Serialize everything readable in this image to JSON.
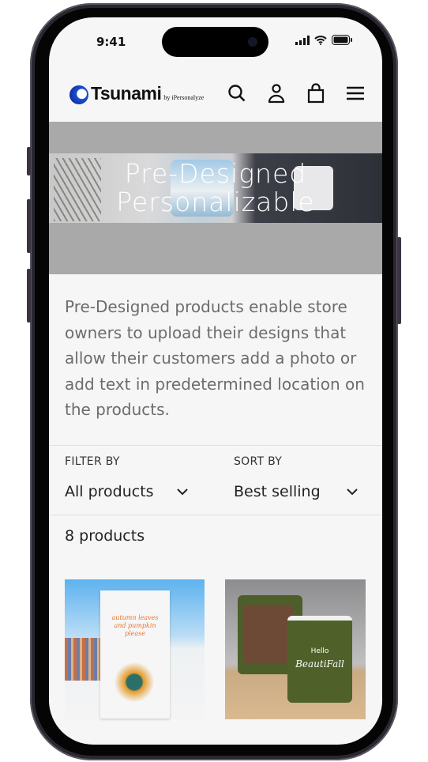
{
  "status_bar": {
    "time": "9:41"
  },
  "header": {
    "logo_text": "Tsunami",
    "logo_byline": "by iPersonalyze",
    "icons": [
      "search-icon",
      "account-icon",
      "cart-icon",
      "menu-icon"
    ]
  },
  "banner": {
    "title_line1": "Pre-Designed",
    "title_line2": "Personalizable"
  },
  "description": "Pre-Designed products enable store owners to upload their designs that allow their customers add a photo or add text in predetermined location on the products.",
  "filter": {
    "label": "FILTER BY",
    "value": "All products"
  },
  "sort": {
    "label": "SORT BY",
    "value": "Best selling"
  },
  "product_count": "8 products",
  "products": [
    {
      "image_text": "autumn leaves and pumpkin please"
    },
    {
      "image_text_small": "Hello",
      "image_text_script": "BeautiFall"
    }
  ]
}
